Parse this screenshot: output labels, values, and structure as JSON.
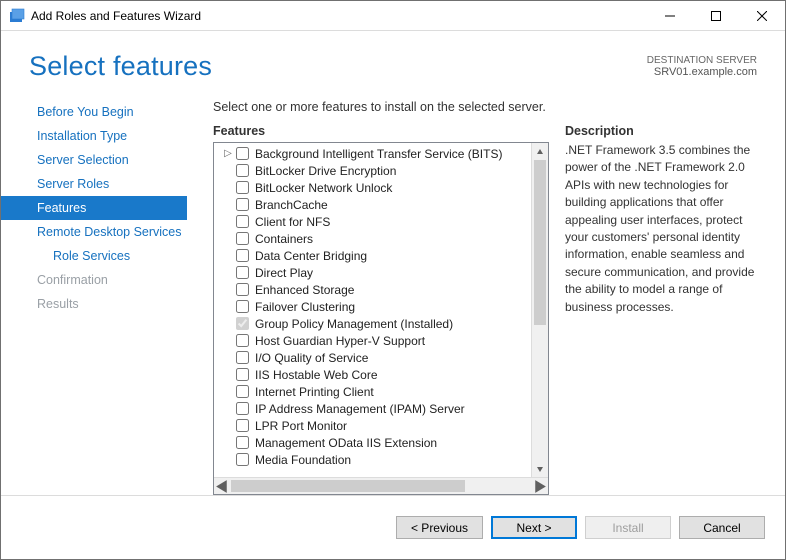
{
  "titlebar": {
    "title": "Add Roles and Features Wizard"
  },
  "header": {
    "title": "Select features",
    "dest_label": "DESTINATION SERVER",
    "dest_value": "SRV01.example.com"
  },
  "nav": {
    "items": [
      {
        "label": "Before You Begin",
        "state": "normal"
      },
      {
        "label": "Installation Type",
        "state": "normal"
      },
      {
        "label": "Server Selection",
        "state": "normal"
      },
      {
        "label": "Server Roles",
        "state": "normal"
      },
      {
        "label": "Features",
        "state": "selected"
      },
      {
        "label": "Remote Desktop Services",
        "state": "normal"
      },
      {
        "label": "Role Services",
        "state": "normal",
        "sub": true
      },
      {
        "label": "Confirmation",
        "state": "disabled"
      },
      {
        "label": "Results",
        "state": "disabled"
      }
    ]
  },
  "main": {
    "instruction": "Select one or more features to install on the selected server.",
    "features_label": "Features",
    "description_label": "Description",
    "description_text": ".NET Framework 3.5 combines the power of the .NET Framework 2.0 APIs with new technologies for building applications that offer appealing user interfaces, protect your customers' personal identity information, enable seamless and secure communication, and provide the ability to model a range of business processes.",
    "tree": [
      {
        "label": "Background Intelligent Transfer Service (BITS)",
        "checked": false,
        "expandable": true
      },
      {
        "label": "BitLocker Drive Encryption",
        "checked": false
      },
      {
        "label": "BitLocker Network Unlock",
        "checked": false
      },
      {
        "label": "BranchCache",
        "checked": false
      },
      {
        "label": "Client for NFS",
        "checked": false
      },
      {
        "label": "Containers",
        "checked": false
      },
      {
        "label": "Data Center Bridging",
        "checked": false
      },
      {
        "label": "Direct Play",
        "checked": false
      },
      {
        "label": "Enhanced Storage",
        "checked": false
      },
      {
        "label": "Failover Clustering",
        "checked": false
      },
      {
        "label": "Group Policy Management (Installed)",
        "checked": true,
        "disabled": true
      },
      {
        "label": "Host Guardian Hyper-V Support",
        "checked": false
      },
      {
        "label": "I/O Quality of Service",
        "checked": false
      },
      {
        "label": "IIS Hostable Web Core",
        "checked": false
      },
      {
        "label": "Internet Printing Client",
        "checked": false
      },
      {
        "label": "IP Address Management (IPAM) Server",
        "checked": false
      },
      {
        "label": "LPR Port Monitor",
        "checked": false
      },
      {
        "label": "Management OData IIS Extension",
        "checked": false
      },
      {
        "label": "Media Foundation",
        "checked": false
      }
    ]
  },
  "footer": {
    "previous": "< Previous",
    "next": "Next >",
    "install": "Install",
    "cancel": "Cancel"
  }
}
